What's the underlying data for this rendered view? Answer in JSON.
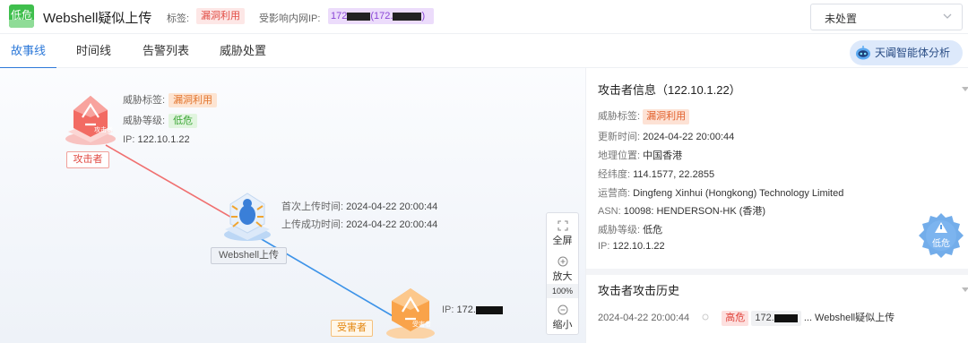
{
  "header": {
    "level_badge": "低危",
    "title": "Webshell疑似上传",
    "tag_label": "标签:",
    "tag_value": "漏洞利用",
    "affected_label": "受影响内网IP:",
    "affected_prefix": "172",
    "affected_middle": "(172.",
    "status_value": "未处置"
  },
  "tabs": [
    "故事线",
    "时间线",
    "告警列表",
    "威胁处置"
  ],
  "ai_button": "天阗智能体分析",
  "graph": {
    "attacker": {
      "caption": "攻击者",
      "icon_text": "攻击者",
      "threat_tag_label": "威胁标签:",
      "threat_tag": "漏洞利用",
      "threat_level_label": "威胁等级:",
      "threat_level": "低危",
      "ip_label": "IP:",
      "ip": "122.10.1.22"
    },
    "webshell": {
      "caption": "Webshell上传",
      "first_upload_label": "首次上传时间:",
      "first_upload": "2024-04-22 20:00:44",
      "success_label": "上传成功时间:",
      "success": "2024-04-22 20:00:44"
    },
    "victim": {
      "caption": "受害者",
      "icon_text": "受害者",
      "ip_label": "IP:",
      "ip": "172."
    },
    "colors": {
      "attack_line": "#f07070",
      "upload_line": "#3d93e8"
    }
  },
  "zoom": {
    "fullscreen": "全屏",
    "zoom_in": "放大",
    "percent": "100%",
    "zoom_out": "缩小"
  },
  "attacker_info": {
    "title": "攻击者信息（122.10.1.22）",
    "rows": [
      {
        "k": "威胁标签:",
        "v": "漏洞利用"
      },
      {
        "k": "更新时间:",
        "v": "2024-04-22 20:00:44"
      },
      {
        "k": "地理位置:",
        "v": "中国香港"
      },
      {
        "k": "经纬度:",
        "v": "114.1577, 22.2855"
      },
      {
        "k": "运营商:",
        "v": "Dingfeng Xinhui (Hongkong) Technology Limited"
      },
      {
        "k": "ASN:",
        "v": "10098: HENDERSON-HK (香港)"
      },
      {
        "k": "威胁等级:",
        "v": "低危"
      },
      {
        "k": "IP:",
        "v": "122.10.1.22"
      }
    ],
    "level_badge": "低危"
  },
  "attack_history": {
    "title": "攻击者攻击历史",
    "items": [
      {
        "time": "2024-04-22 20:00:44",
        "level": "高危",
        "ip": "172.",
        "desc": "... Webshell疑似上传"
      }
    ]
  }
}
